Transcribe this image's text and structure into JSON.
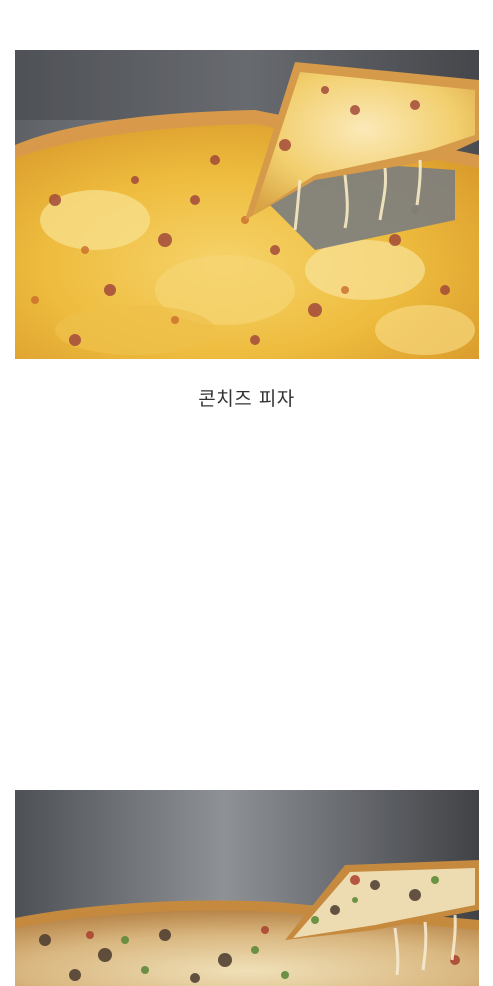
{
  "posts": [
    {
      "photo_subject": "corn-cheese-pizza",
      "caption": "콘치즈 피자"
    },
    {
      "photo_subject": "topped-pizza-slice",
      "caption": ""
    }
  ],
  "colors": {
    "background": "#ffffff",
    "caption_text": "#333333",
    "cheese": "#f2c94c",
    "crust": "#d89a4a",
    "pan": "#6b6e73"
  }
}
